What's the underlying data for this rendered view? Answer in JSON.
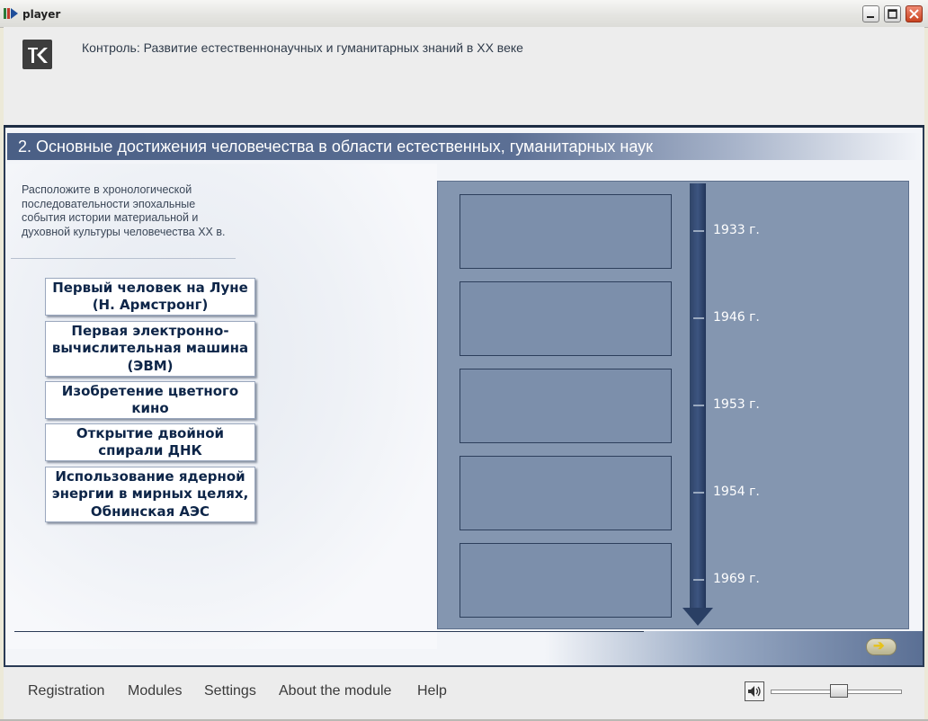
{
  "window": {
    "title": "player"
  },
  "header": {
    "title": "Контроль: Развитие естественнонаучных и гуманитарных знаний в ХХ веке"
  },
  "section": {
    "title": "2. Основные достижения человечества в области естественных, гуманитарных наук"
  },
  "instructions": "Расположите в хронологической последовательности эпохальные события истории материальной и духовной культуры человечества ХХ в.",
  "cards": [
    "Первый человек на Луне (Н. Армстронг)",
    "Первая электронно-вычислительная машина (ЭВМ)",
    "Изобретение цветного кино",
    "Открытие двойной спирали ДНК",
    "Использование ядерной энергии в мирных целях, Обнинская АЭС"
  ],
  "timeline": {
    "years": [
      "1933 г.",
      "1946 г.",
      "1953 г.",
      "1954 г.",
      "1969 г."
    ]
  },
  "footer": {
    "menu": [
      "Registration",
      "Modules",
      "Settings",
      "About the module",
      "Help"
    ]
  },
  "volume": {
    "level": 0.52
  },
  "colors": {
    "accent": "#4a5f85",
    "panel": "#8496b0",
    "card_text": "#0d2548"
  }
}
